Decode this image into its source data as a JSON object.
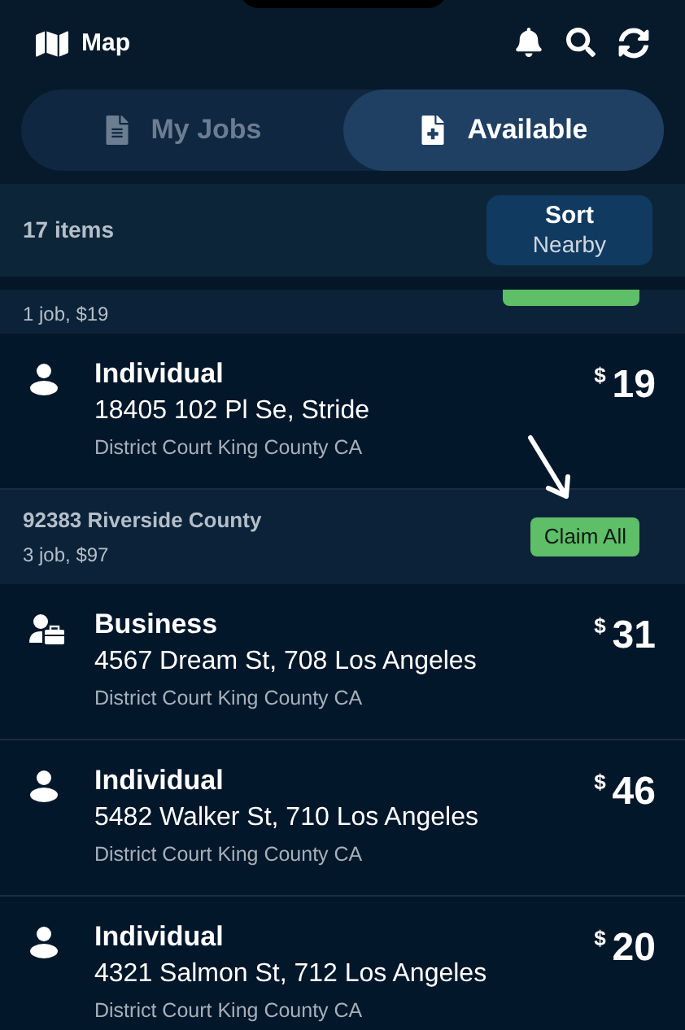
{
  "header": {
    "map_label": "Map"
  },
  "tabs": [
    {
      "label": "My Jobs",
      "selected": false
    },
    {
      "label": "Available",
      "selected": true
    }
  ],
  "toolbar": {
    "count": "17 items",
    "sort_title": "Sort",
    "sort_value": "Nearby"
  },
  "list": [
    {
      "kind": "group",
      "subtitle": "1 job, $19",
      "claim_cut": true
    },
    {
      "kind": "individual",
      "title": "Individual",
      "address": "18405 102 Pl Se, Stride",
      "court": "District Court King County CA",
      "currency": "$",
      "amount": "19"
    },
    {
      "kind": "group",
      "title": "92383 Riverside County",
      "subtitle": "3 job, $97",
      "claim": "Claim All",
      "pointer": true
    },
    {
      "kind": "business",
      "title": "Business",
      "address": "4567 Dream St, 708 Los Angeles",
      "court": "District Court King County CA",
      "currency": "$",
      "amount": "31"
    },
    {
      "kind": "individual",
      "title": "Individual",
      "address": "5482 Walker St, 710 Los Angeles",
      "court": "District Court King County CA",
      "currency": "$",
      "amount": "46"
    },
    {
      "kind": "individual",
      "title": "Individual",
      "address": "4321 Salmon St, 712 Los Angeles",
      "court": "District Court King County CA",
      "currency": "$",
      "amount": "20"
    }
  ]
}
